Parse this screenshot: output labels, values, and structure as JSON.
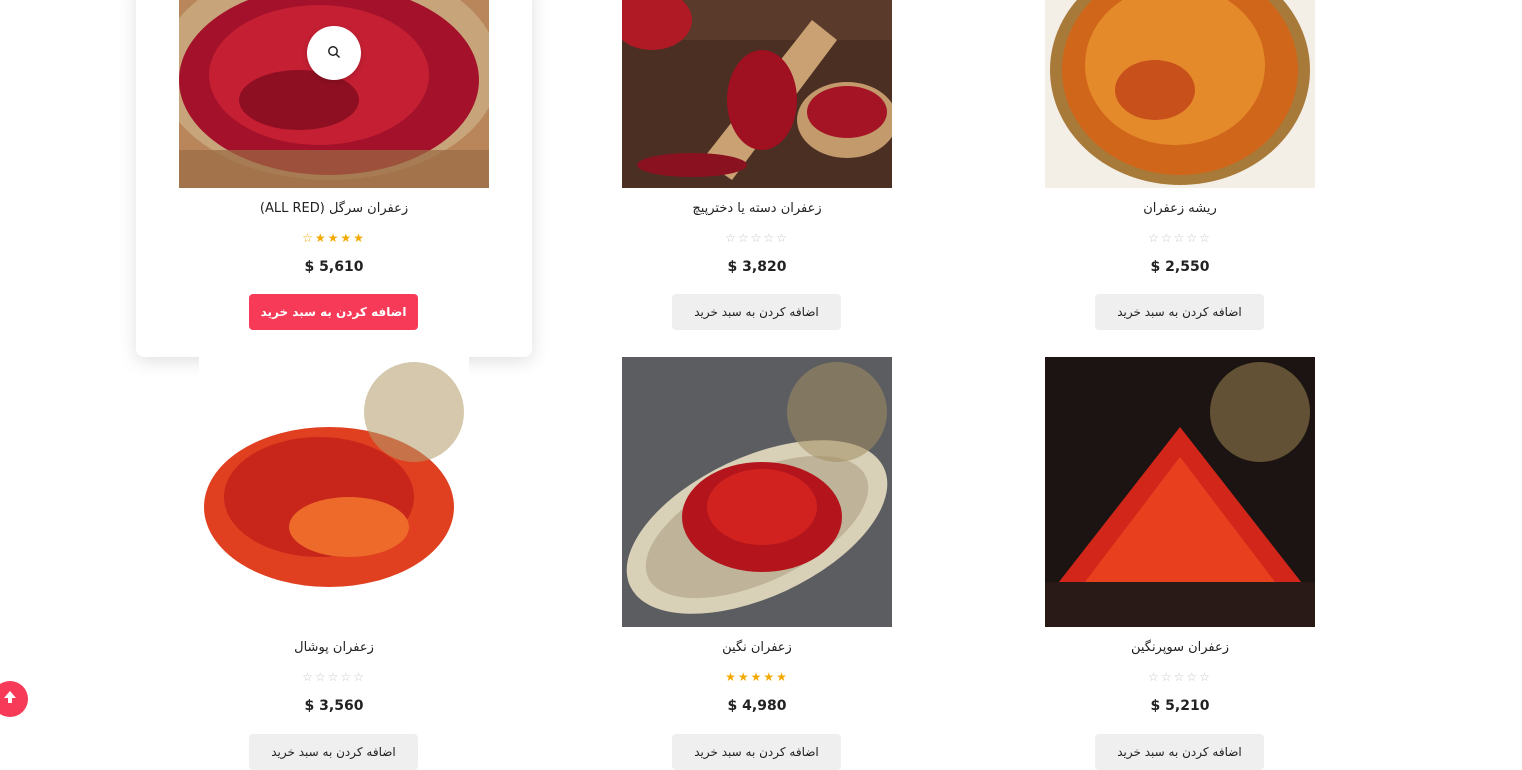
{
  "products": [
    {
      "title": "زعفران سرگل (ALL RED)",
      "price": "$ 5,610",
      "button": "اضافه کردن به سبد خرید",
      "stars": "☆★★★★",
      "rated": true
    },
    {
      "title": "زعفران دسته یا دخترپیچ",
      "price": "$ 3,820",
      "button": "اضافه کردن به سبد خرید",
      "stars": "☆☆☆☆☆",
      "rated": false
    },
    {
      "title": "ریشه زعفران",
      "price": "$ 2,550",
      "button": "اضافه کردن به سبد خرید",
      "stars": "☆☆☆☆☆",
      "rated": false
    },
    {
      "title": "زعفران پوشال",
      "price": "$ 3,560",
      "button": "اضافه کردن به سبد خرید",
      "stars": "☆☆☆☆☆",
      "rated": false
    },
    {
      "title": "زعفران نگین",
      "price": "$ 4,980",
      "button": "اضافه کردن به سبد خرید",
      "stars": "★★★★★",
      "rated": true
    },
    {
      "title": "زعفران سوپرنگین",
      "price": "$ 5,210",
      "button": "اضافه کردن به سبد خرید",
      "stars": "☆☆☆☆☆",
      "rated": false
    }
  ],
  "icons": {
    "quickview": "search-icon",
    "scroll_top": "arrow-up-icon"
  },
  "colors": {
    "accent": "#f73a57",
    "star": "#f2a900"
  }
}
